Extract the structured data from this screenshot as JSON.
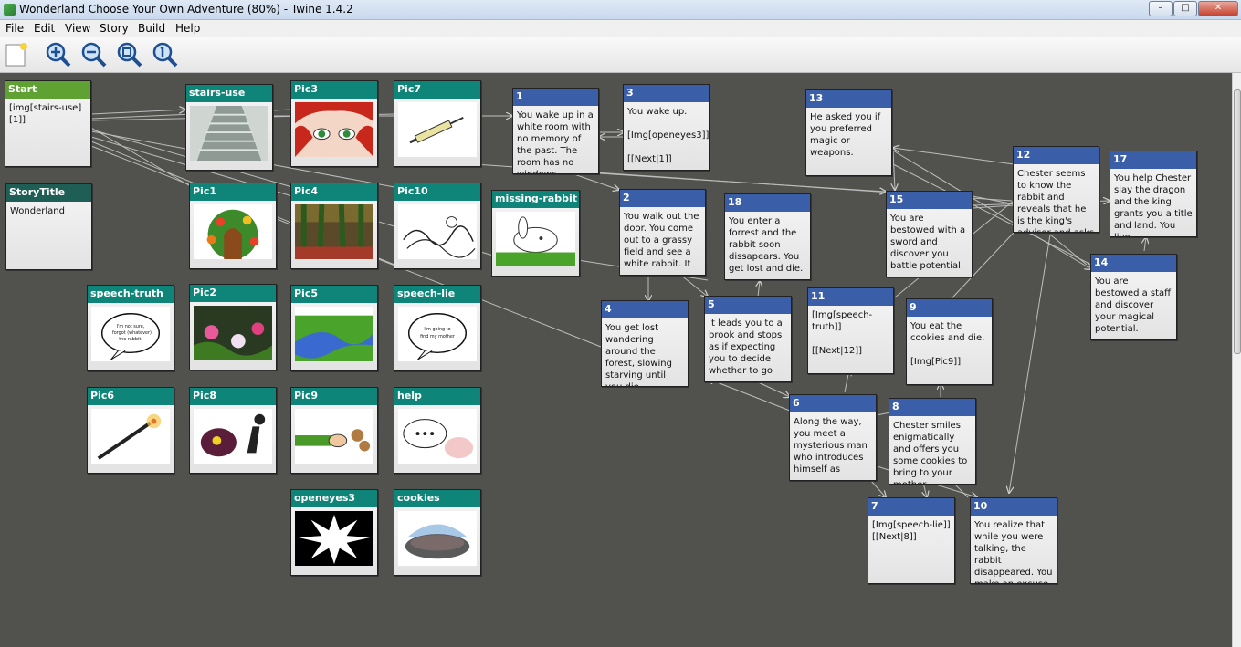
{
  "window": {
    "title": "Wonderland Choose Your Own Adventure (80%) - Twine 1.4.2"
  },
  "menu": [
    "File",
    "Edit",
    "View",
    "Story",
    "Build",
    "Help"
  ],
  "toolbar": {
    "icons": [
      "new-passage-icon",
      "zoom-in-icon",
      "zoom-out-icon",
      "zoom-fit-icon",
      "zoom-actual-icon"
    ]
  },
  "passages": {
    "start": {
      "title": "Start",
      "text": "[img[stairs-use][1]]"
    },
    "storytitle": {
      "title": "StoryTitle",
      "text": "Wonderland"
    },
    "stairs_use": {
      "title": "stairs-use"
    },
    "pic3": {
      "title": "Pic3"
    },
    "pic7": {
      "title": "Pic7"
    },
    "pic1": {
      "title": "Pic1"
    },
    "pic4": {
      "title": "Pic4"
    },
    "pic10": {
      "title": "Pic10"
    },
    "missing_rabbit": {
      "title": "missing-rabbit"
    },
    "speech_truth": {
      "title": "speech-truth"
    },
    "pic2": {
      "title": "Pic2"
    },
    "pic5": {
      "title": "Pic5"
    },
    "speech_lie": {
      "title": "speech-lie"
    },
    "pic6": {
      "title": "Pic6"
    },
    "pic8": {
      "title": "Pic8"
    },
    "pic9": {
      "title": "Pic9"
    },
    "help": {
      "title": "help"
    },
    "openeyes3": {
      "title": "openeyes3"
    },
    "cookies": {
      "title": "cookies"
    },
    "p1": {
      "title": "1",
      "text": "You wake up in a white room with no memory of the past. The room has no windows"
    },
    "p3": {
      "title": "3",
      "text": "You wake up.\n\n[Img[openeyes3]]\n\n[[Next|1]]"
    },
    "p13": {
      "title": "13",
      "text": "He asked you if you preferred magic or weapons."
    },
    "p12": {
      "title": "12",
      "text": "Chester seems to know the rabbit and reveals that he is the king's advisor and asks"
    },
    "p17": {
      "title": "17",
      "text": "You help Chester slay the dragon and the king grants you a title and land. You live"
    },
    "p2": {
      "title": "2",
      "text": "You walk out the door. You come out to a grassy field and see a white rabbit. It"
    },
    "p18": {
      "title": "18",
      "text": "You enter a forrest and the rabbit soon dissapears. You get lost and die."
    },
    "p15": {
      "title": "15",
      "text": "You are bestowed with a sword and discover you battle potential."
    },
    "p14": {
      "title": "14",
      "text": "You are bestowed a staff and discover your magical potential."
    },
    "p4": {
      "title": "4",
      "text": "You get lost wandering around the forest, slowing starving until you die."
    },
    "p5": {
      "title": "5",
      "text": "It leads you to a brook and stops as if expecting you to decide whether to go"
    },
    "p11": {
      "title": "11",
      "text": "[Img[speech-truth]]\n\n[[Next|12]]"
    },
    "p9": {
      "title": "9",
      "text": "You eat the cookies and die.\n\n[Img[Pic9]]"
    },
    "p6": {
      "title": "6",
      "text": "Along the way, you meet a mysterious man who introduces himself as"
    },
    "p8": {
      "title": "8",
      "text": "Chester smiles enigmatically and offers you some cookies to bring to your mother"
    },
    "p7": {
      "title": "7",
      "text": "[Img[speech-lie]]\n[[Next|8]]"
    },
    "p10": {
      "title": "10",
      "text": "You realize that while you were talking, the rabbit disappeared. You make an excuse"
    }
  },
  "images": {
    "speech_truth_text": "I'm not sure, I forgot (whatever) the rabbit.",
    "speech_lie_text": "I'm going to find my mother"
  }
}
